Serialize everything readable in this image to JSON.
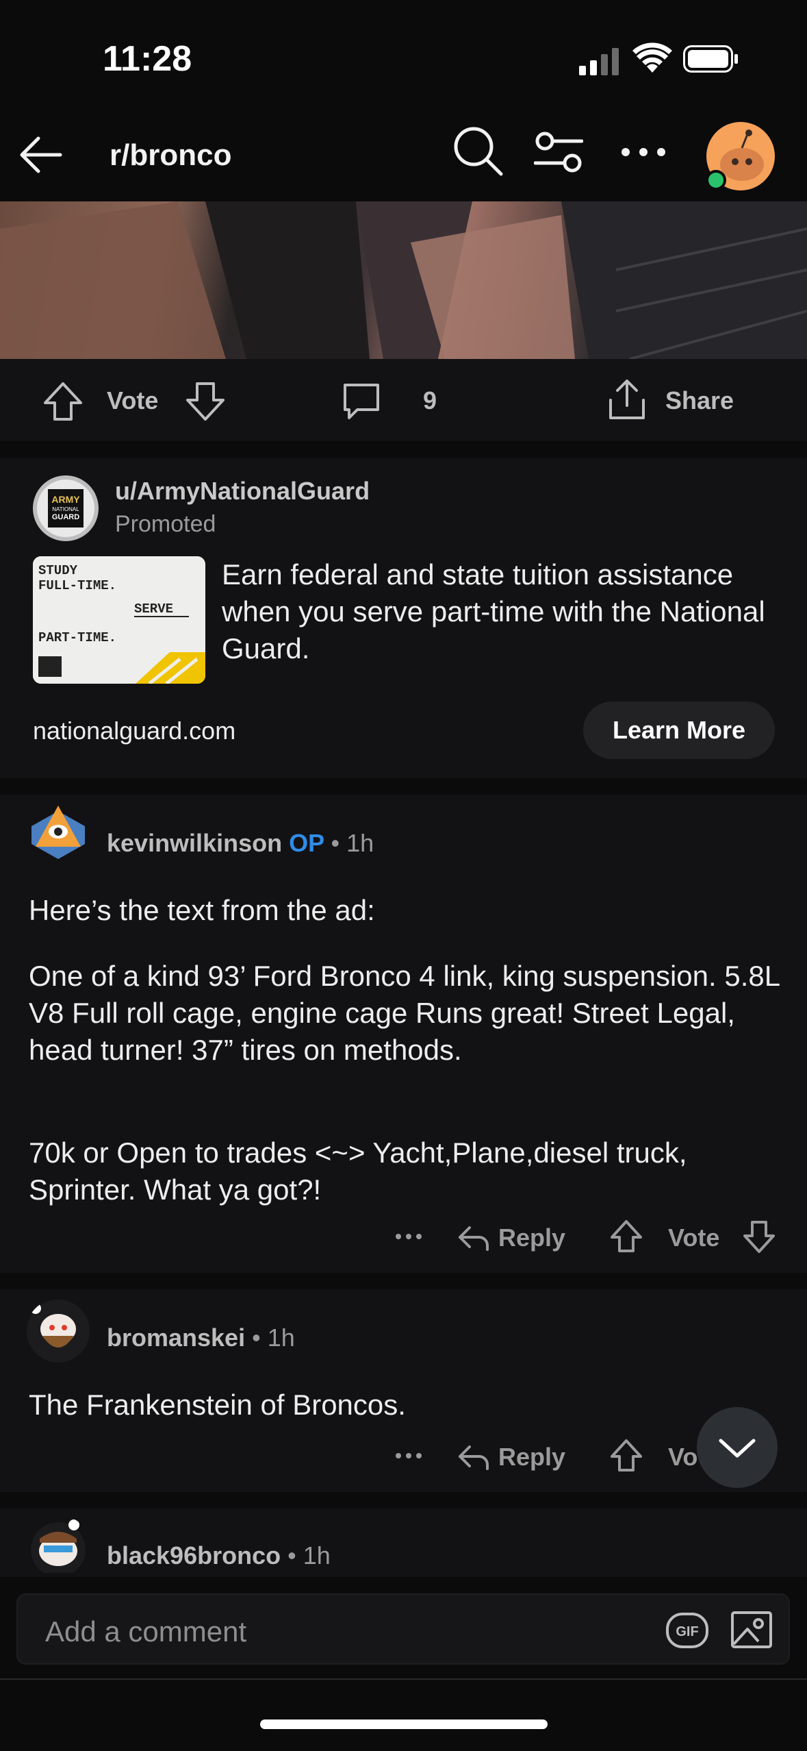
{
  "status_bar": {
    "time": "11:28"
  },
  "nav": {
    "title": "r/bronco"
  },
  "post_actions": {
    "vote_label": "Vote",
    "comment_count": "9",
    "share_label": "Share"
  },
  "ad": {
    "username": "u/ArmyNationalGuard",
    "promoted_label": "Promoted",
    "logo_text": [
      "ARMY",
      "NATIONAL",
      "GUARD"
    ],
    "thumb_lines": [
      "STUDY",
      "FULL-TIME.",
      "SERVE",
      "PART-TIME."
    ],
    "text": "Earn federal and state tuition assistance when you serve part-time with the National Guard.",
    "domain": "nationalguard.com",
    "cta": "Learn More"
  },
  "comments": [
    {
      "username": "kevinwilkinson",
      "op_badge": "OP",
      "time": "• 1h",
      "paragraphs": [
        "Here’s the text from the ad:",
        "One of a kind 93’ Ford Bronco 4 link, king suspension. 5.8L V8 Full roll cage, engine cage Runs great! Street Legal, head turner! 37” tires on methods.",
        "70k or Open to trades <~> Yacht,Plane,diesel truck, Sprinter. What ya got?!"
      ],
      "reply_label": "Reply",
      "vote_label": "Vote"
    },
    {
      "username": "bromanskei",
      "time": "• 1h",
      "paragraphs": [
        "The Frankenstein of Broncos."
      ],
      "reply_label": "Reply",
      "vote_label": "Vo"
    },
    {
      "username": "black96bronco",
      "time": "• 1h"
    }
  ],
  "composer": {
    "placeholder": "Add a comment",
    "gif_label": "GIF"
  },
  "colors": {
    "accent_op": "#2f8ce8",
    "online": "#2ac36b",
    "avatar_bg": "#f7a25a"
  }
}
